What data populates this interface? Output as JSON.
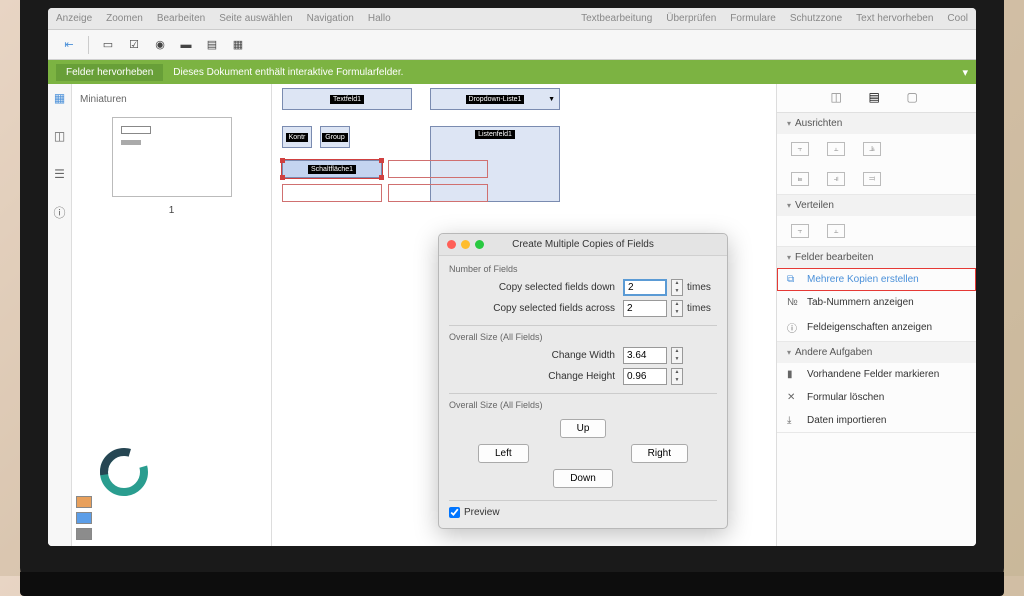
{
  "menubar": {
    "items": [
      "Anzeige",
      "Zoomen",
      "Bearbeiten",
      "Seite auswählen",
      "Navigation",
      "Hallo",
      "",
      "Textbearbeitung",
      "Überprüfen",
      "Formulare",
      "Schutzzone",
      "Text hervorheben",
      "Cool"
    ]
  },
  "greenbar": {
    "badge": "Felder hervorheben",
    "msg": "Dieses Dokument enthält interaktive Formularfelder."
  },
  "thumbs": {
    "title": "Miniaturen",
    "page_num": "1"
  },
  "fields": {
    "textfeld": "Textfeld1",
    "dropdown": "Dropdown-Liste1",
    "kontr": "Kontr",
    "group": "Group",
    "schaltflaeche": "Schaltfläche1",
    "listenfeld": "Listenfeld1"
  },
  "rightpanel": {
    "sec_ausrichten": "Ausrichten",
    "sec_verteilen": "Verteilen",
    "sec_felder": "Felder bearbeiten",
    "item_kopien": "Mehrere Kopien erstellen",
    "item_tab": "Tab-Nummern anzeigen",
    "item_eigenschaften": "Feldeigenschaften anzeigen",
    "sec_andere": "Andere Aufgaben",
    "item_markieren": "Vorhandene Felder markieren",
    "item_loeschen": "Formular löschen",
    "item_import": "Daten importieren"
  },
  "dialog": {
    "title": "Create Multiple Copies of Fields",
    "sec_number": "Number of Fields",
    "row_down": "Copy selected fields down",
    "val_down": "2",
    "row_across": "Copy selected fields across",
    "val_across": "2",
    "suffix": "times",
    "sec_size1": "Overall Size (All Fields)",
    "row_width": "Change Width",
    "val_width": "3.64",
    "row_height": "Change Height",
    "val_height": "0.96",
    "sec_size2": "Overall Size (All Fields)",
    "btn_up": "Up",
    "btn_left": "Left",
    "btn_right": "Right",
    "btn_down": "Down",
    "preview": "Preview"
  }
}
